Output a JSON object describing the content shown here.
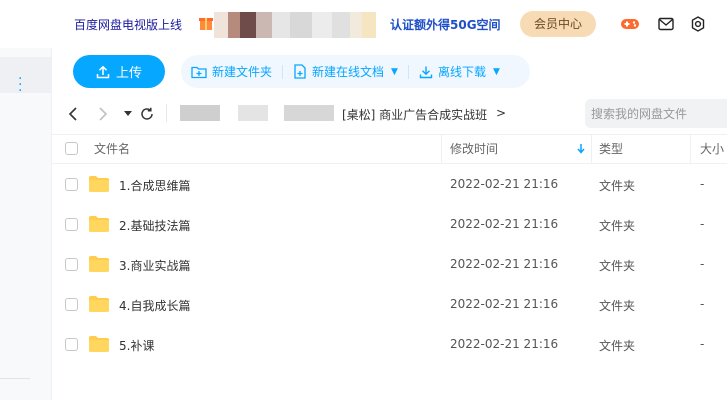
{
  "topbar": {
    "tv_link": "百度网盘电视版上线",
    "cert_link": "认证额外得50G空间",
    "vip_button": "会员中心",
    "icons": [
      "gamepad-icon",
      "mail-icon",
      "settings-icon"
    ]
  },
  "toolbar": {
    "upload_label": "上传",
    "new_folder_label": "新建文件夹",
    "new_online_doc_label": "新建在线文档",
    "offline_download_label": "离线下载"
  },
  "nav": {
    "breadcrumb_current": "[桌松] 商业广告合成实战班",
    "breadcrumb_arrow": ">",
    "search_placeholder": "搜索我的网盘文件"
  },
  "table": {
    "columns": {
      "name": "文件名",
      "mtime": "修改时间",
      "type": "类型",
      "size": "大小"
    },
    "rows": [
      {
        "name": "1.合成思维篇",
        "mtime": "2022-02-21 21:16",
        "type": "文件夹",
        "size": "-"
      },
      {
        "name": "2.基础技法篇",
        "mtime": "2022-02-21 21:16",
        "type": "文件夹",
        "size": "-"
      },
      {
        "name": "3.商业实战篇",
        "mtime": "2022-02-21 21:16",
        "type": "文件夹",
        "size": "-"
      },
      {
        "name": "4.自我成长篇",
        "mtime": "2022-02-21 21:16",
        "type": "文件夹",
        "size": "-"
      },
      {
        "name": "5.补课",
        "mtime": "2022-02-21 21:16",
        "type": "文件夹",
        "size": "-"
      }
    ]
  },
  "colors": {
    "accent": "#06a7ff",
    "folder": "#ffcc4d",
    "vip_bg": "#f6dbb5",
    "cert_text": "#1e4fc7"
  }
}
